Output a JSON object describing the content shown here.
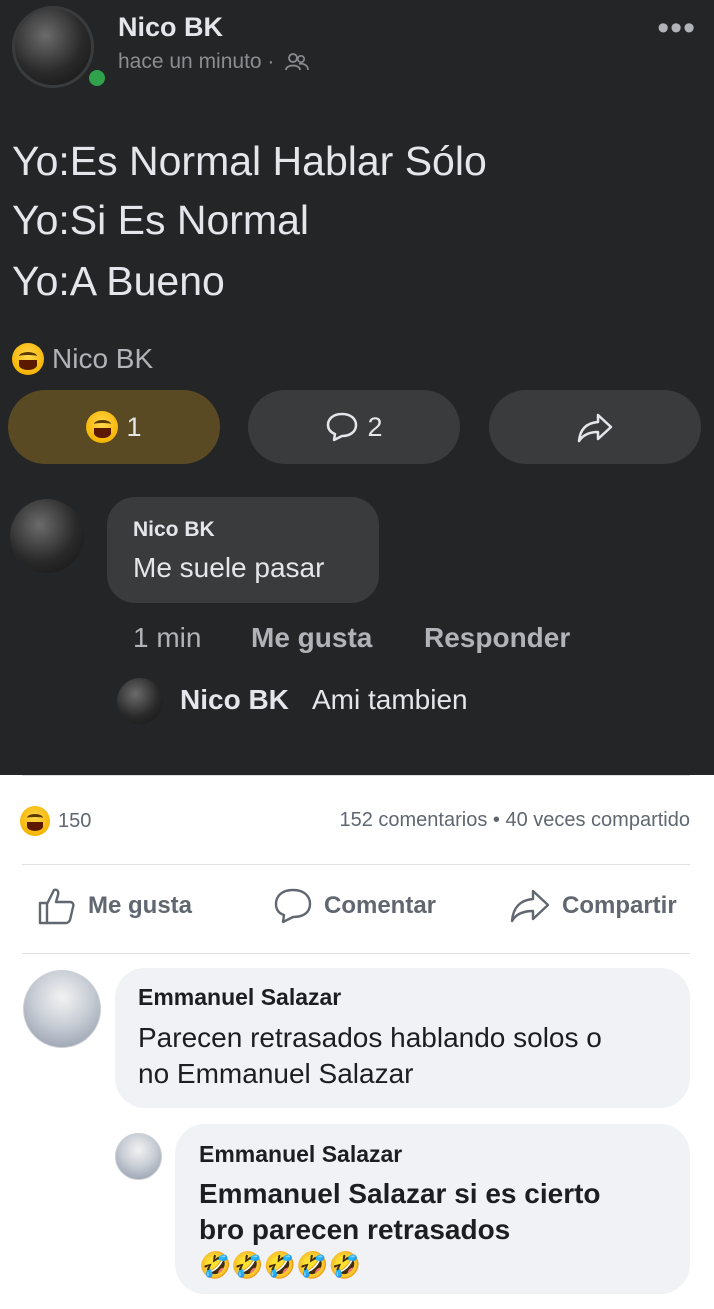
{
  "post": {
    "author": "Nico BK",
    "time": "hace un minuto ·",
    "privacy_icon": "friends-icon",
    "lines": [
      "Yo:Es Normal Hablar Sólo",
      "Yo:Si Es Normal",
      "Yo:A Bueno"
    ],
    "reactor_name": "Nico BK",
    "react_count": "1",
    "comment_count": "2"
  },
  "comment": {
    "author": "Nico BK",
    "text": "Me suele pasar",
    "time": "1 min",
    "like_label": "Me gusta",
    "reply_label": "Responder"
  },
  "reply": {
    "author": "Nico BK",
    "text": "Ami tambien"
  },
  "stats": {
    "reactions": "150",
    "right": "152 comentarios • 40 veces compartido"
  },
  "actions": {
    "like": "Me gusta",
    "comment": "Comentar",
    "share": "Compartir"
  },
  "fb_comments": [
    {
      "author": "Emmanuel Salazar",
      "lines": [
        "Parecen retrasados hablando solos o",
        "no Emmanuel Salazar"
      ]
    },
    {
      "author": "Emmanuel Salazar",
      "lines": [
        "Emmanuel Salazar si es cierto",
        "bro parecen retrasados"
      ],
      "emoji": "🤣🤣🤣🤣🤣"
    }
  ],
  "colors": {
    "dark_bg": "#242526",
    "online": "#31a24c",
    "light_bubble": "#f0f2f5",
    "text_muted": "#606770"
  }
}
